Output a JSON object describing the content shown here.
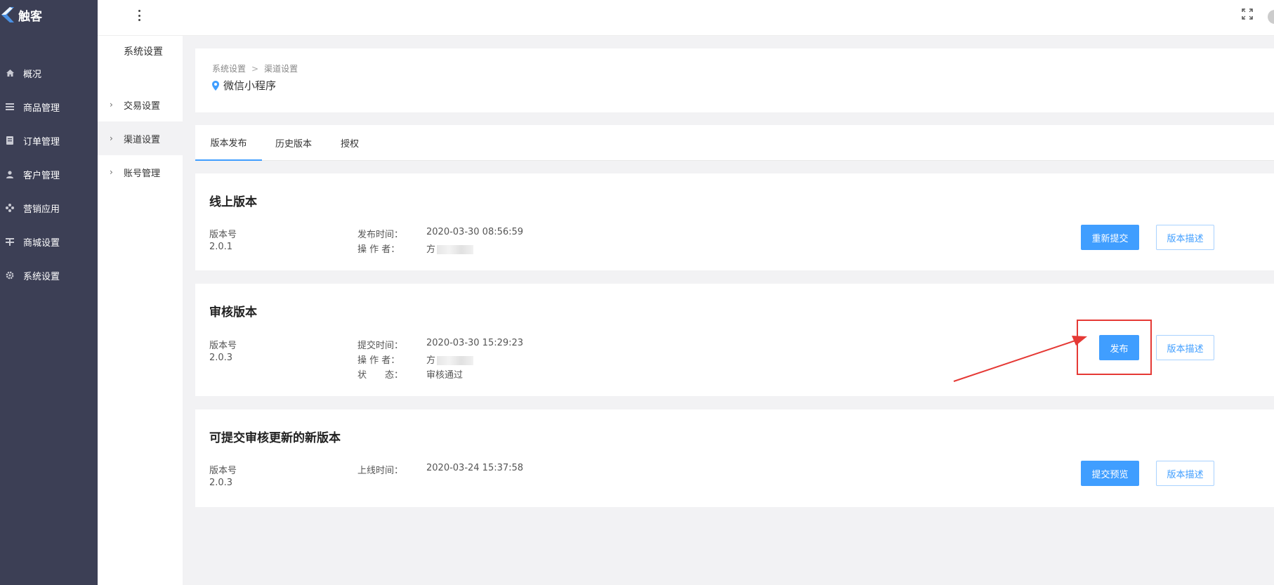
{
  "app": {
    "logo_text": "触客"
  },
  "sidebar": {
    "items": [
      {
        "label": "概况",
        "icon": "home-icon"
      },
      {
        "label": "商品管理",
        "icon": "list-icon"
      },
      {
        "label": "订单管理",
        "icon": "document-icon"
      },
      {
        "label": "客户管理",
        "icon": "user-icon"
      },
      {
        "label": "营销应用",
        "icon": "apps-icon"
      },
      {
        "label": "商城设置",
        "icon": "store-icon"
      },
      {
        "label": "系统设置",
        "icon": "gear-icon"
      }
    ]
  },
  "subsidebar": {
    "title": "系统设置",
    "items": [
      {
        "label": "交易设置",
        "active": false
      },
      {
        "label": "渠道设置",
        "active": true
      },
      {
        "label": "账号管理",
        "active": false
      }
    ]
  },
  "breadcrumb": {
    "items": [
      "系统设置",
      "渠道设置"
    ],
    "separator": ">"
  },
  "page": {
    "title": "微信小程序"
  },
  "tabs": [
    {
      "label": "版本发布",
      "active": true
    },
    {
      "label": "历史版本",
      "active": false
    },
    {
      "label": "授权",
      "active": false
    }
  ],
  "online": {
    "title": "线上版本",
    "version_label": "版本号",
    "version": "2.0.1",
    "time_label": "发布时间：",
    "time": "2020-03-30 08:56:59",
    "operator_label": "操 作 者：",
    "operator": "方",
    "resubmit_button": "重新提交",
    "desc_button": "版本描述"
  },
  "review": {
    "title": "审核版本",
    "version_label": "版本号",
    "version": "2.0.3",
    "time_label": "提交时间：",
    "time": "2020-03-30 15:29:23",
    "operator_label": "操 作 者：",
    "operator": "方",
    "status_label": "状　　态：",
    "status": "审核通过",
    "publish_button": "发布",
    "desc_button": "版本描述"
  },
  "new_version": {
    "title": "可提交审核更新的新版本",
    "version_label": "版本号",
    "version": "2.0.3",
    "time_label": "上线时间：",
    "time": "2020-03-24 15:37:58",
    "preview_button": "提交预览",
    "desc_button": "版本描述"
  },
  "colors": {
    "sidebar_bg": "#3c3f55",
    "primary": "#409eff",
    "annotation": "#e53935"
  }
}
